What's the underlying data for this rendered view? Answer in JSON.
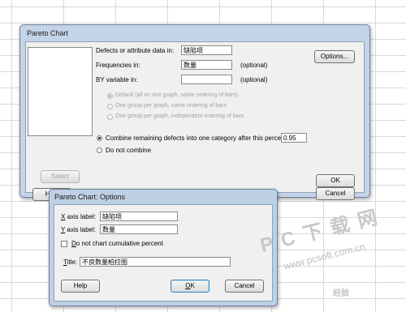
{
  "main_dialog": {
    "title": "Pareto Chart",
    "defects_label": "Defects or attribute data in:",
    "defects_value": "缺陷项",
    "frequencies_label": "Frequencies in:",
    "frequencies_value": "数量",
    "frequencies_hint": "(optional)",
    "by_label": "BY variable in:",
    "by_value": "",
    "by_hint": "(optional)",
    "options_button": "Options...",
    "radio_default": "Default (all on one graph, same ordering of bars)",
    "radio_one_group_same": "One group per graph, same ordering of bars",
    "radio_one_group_indep": "One group per graph, independent ordering of bars",
    "combine_label": "Combine remaining defects into one category after this percent:",
    "combine_value": "0.95",
    "do_not_combine_label": "Do not combine",
    "select_button": "Select",
    "help_button": "Help",
    "ok_button": "OK",
    "cancel_button": "Cancel"
  },
  "options_dialog": {
    "title": "Pareto Chart: Options",
    "x_label_prefix": "X",
    "x_label_rest": " axis label:",
    "x_value": "缺陷项",
    "y_label_prefix": "Y",
    "y_label_rest": " axis label:",
    "y_value": "数量",
    "no_cumulative_prefix": "D",
    "no_cumulative_rest": "o not chart cumulative percent",
    "title_prefix": "T",
    "title_rest": "itle:",
    "title_value": "不良数量柏拉图",
    "help_button": "Help",
    "ok_prefix": "O",
    "ok_rest": "K",
    "cancel_button": "Cancel"
  },
  "watermark": {
    "chars": "P C 下 载 网",
    "url": "www.pcsoft.com.cn",
    "badge": "经验"
  }
}
